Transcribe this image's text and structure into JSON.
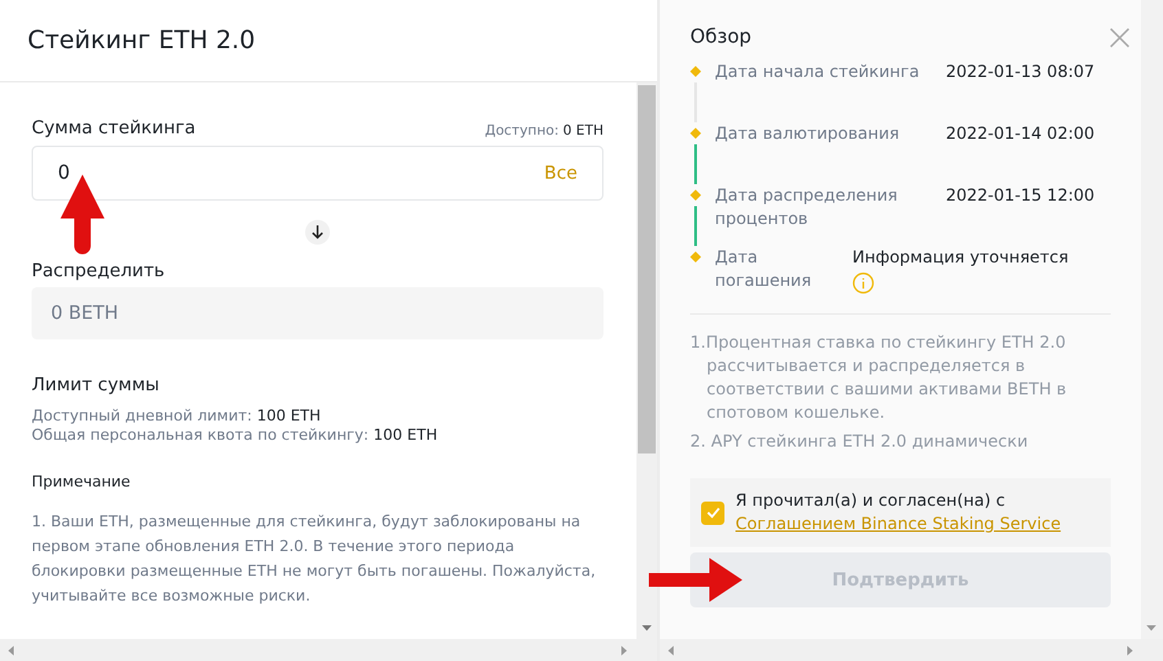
{
  "left": {
    "title": "Стейкинг ETH 2.0",
    "amount": {
      "label": "Сумма стейкинга",
      "available_label": "Доступно:",
      "available_value": "0 ETH",
      "value": "0",
      "max_button": "Все"
    },
    "distribute": {
      "label": "Распределить",
      "value": "0 BETH"
    },
    "limits": {
      "title": "Лимит суммы",
      "rows": [
        {
          "label": "Доступный дневной лимит:",
          "value": "100 ETH"
        },
        {
          "label": "Общая персональная квота по стейкингу:",
          "value": "100 ETH"
        }
      ]
    },
    "note": {
      "title": "Примечание",
      "paragraphs": [
        "1. Ваши ETH, размещенные для стейкинга, будут заблокированы на первом этапе обновления ETH 2.0. В течение этого периода блокировки размещенные ETH не могут быть погашены. Пожалуйста, учитывайте все возможные риски."
      ]
    }
  },
  "right": {
    "title": "Обзор",
    "timeline": [
      {
        "label": "Дата начала стейкинга",
        "value": "2022-01-13 08:07",
        "connector_done": false
      },
      {
        "label": "Дата валютирования",
        "value": "2022-01-14 02:00",
        "connector_done": true
      },
      {
        "label": "Дата распределения процентов",
        "value": "2022-01-15 12:00",
        "connector_done": true
      },
      {
        "label": "Дата погашения",
        "value": "Информация уточняется",
        "info": true
      }
    ],
    "notes": [
      "1.Процентная ставка по стейкингу ETH 2.0 рассчитывается и распределяется в соответствии с вашими активами BETH в спотовом кошельке.",
      "2. APY стейкинга ETH 2.0 динамически"
    ],
    "agreement": {
      "checked": true,
      "text": "Я прочитал(а) и согласен(на) с",
      "link": "Соглашением Binance Staking Service"
    },
    "confirm": {
      "label": "Подтвердить",
      "disabled": true
    }
  }
}
